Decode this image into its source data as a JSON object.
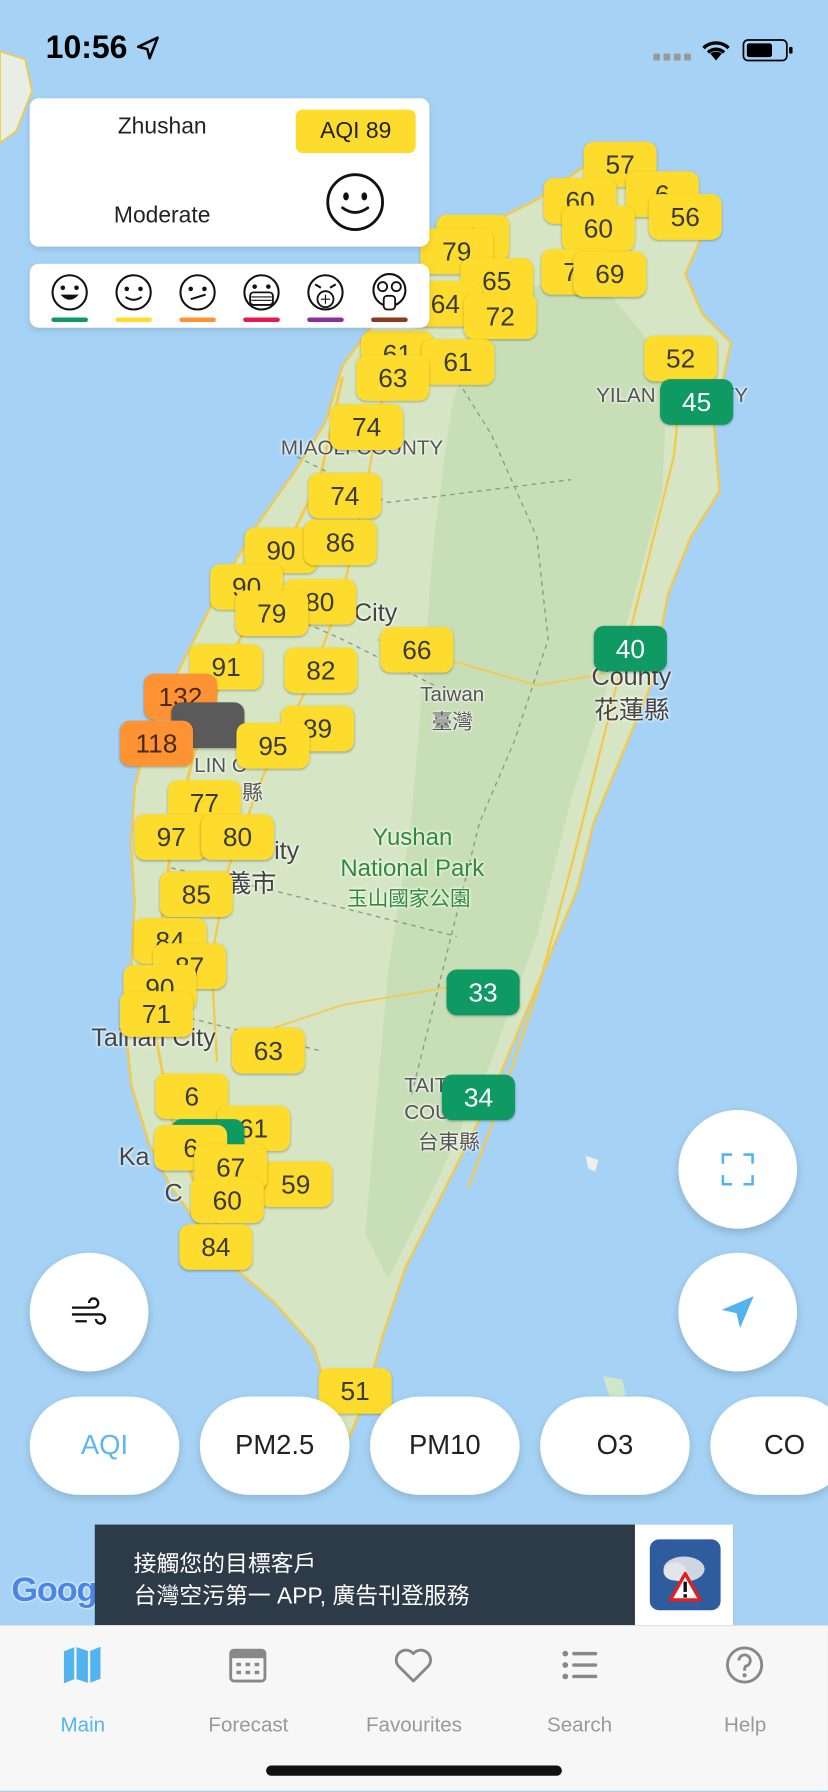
{
  "status_bar": {
    "time": "10:56"
  },
  "station_card": {
    "station": "Zhushan",
    "aqi_label": "AQI 89",
    "level": "Moderate"
  },
  "legend": {
    "levels": [
      {
        "icon": "happy-face-icon",
        "color": "#0f9a64"
      },
      {
        "icon": "smile-face-icon",
        "color": "#fddc2d"
      },
      {
        "icon": "uneasy-face-icon",
        "color": "#ff9233"
      },
      {
        "icon": "mask-face-icon",
        "color": "#e5194f"
      },
      {
        "icon": "respirator-face-icon",
        "color": "#8d2d9e"
      },
      {
        "icon": "gas-mask-face-icon",
        "color": "#8a3a1e"
      }
    ]
  },
  "map_labels": {
    "yilan": "YILAN COUNTY",
    "miaoli": "MIAOLI COUNTY",
    "taichung": "City",
    "taiwan_en": "Taiwan",
    "taiwan_zh": "臺灣",
    "hualien_en": "County",
    "hualien_zh": "花蓮縣",
    "yunlin": "LIN C",
    "yunlin_zh": "縣",
    "chiayi": "ity",
    "chiayi_zh": "義市",
    "yushan_1": "Yushan",
    "yushan_2": "National Park",
    "yushan_zh": "玉山國家公園",
    "tainan": "Tainan City",
    "taitung_1": "TAIT",
    "taitung_2": "COU",
    "taitung_zh": "台東縣",
    "kaohsiung": "Ka",
    "kaohsiung_2": "C"
  },
  "markers": {
    "m57": "57",
    "m56": "56",
    "m79": "79",
    "m65": "65",
    "m69": "69",
    "m64": "64",
    "m72a": "72",
    "m61": "61",
    "m72b": "72",
    "m63a": "63",
    "m52": "52",
    "m45": "45",
    "m74a": "74",
    "m74b": "74",
    "m86": "86",
    "m90": "90",
    "m79b": "79",
    "m80a": "80",
    "m66": "66",
    "m91": "91",
    "m82": "82",
    "m40": "40",
    "m132": "132",
    "m118": "118",
    "m89": "89",
    "m95": "95",
    "m77": "77",
    "m97": "97",
    "m80b": "80",
    "m85": "85",
    "m84a": "84",
    "m87": "87",
    "m90b": "90",
    "m71": "71",
    "m63b": "63",
    "m33": "33",
    "m34": "34",
    "m61b": "61",
    "m67": "67",
    "m59": "59",
    "m60": "60",
    "m84b": "84",
    "m51": "51",
    "m6": "6",
    "m60b": "60",
    "m6b": "6"
  },
  "pollutant_tabs": [
    "AQI",
    "PM2.5",
    "PM10",
    "O3",
    "CO"
  ],
  "google_logo": "Goog",
  "ad": {
    "line1": "接觸您的目標客戶",
    "line2": "台灣空污第一 APP, 廣告刊登服務"
  },
  "tabbar": [
    {
      "label": "Main",
      "icon": "map-icon"
    },
    {
      "label": "Forecast",
      "icon": "calendar-icon"
    },
    {
      "label": "Favourites",
      "icon": "heart-icon"
    },
    {
      "label": "Search",
      "icon": "list-icon"
    },
    {
      "label": "Help",
      "icon": "help-icon"
    }
  ],
  "colors": {
    "good": "#0f9a64",
    "moderate": "#fddc2d",
    "sensitive": "#ff9233",
    "accent": "#52b4ee"
  }
}
